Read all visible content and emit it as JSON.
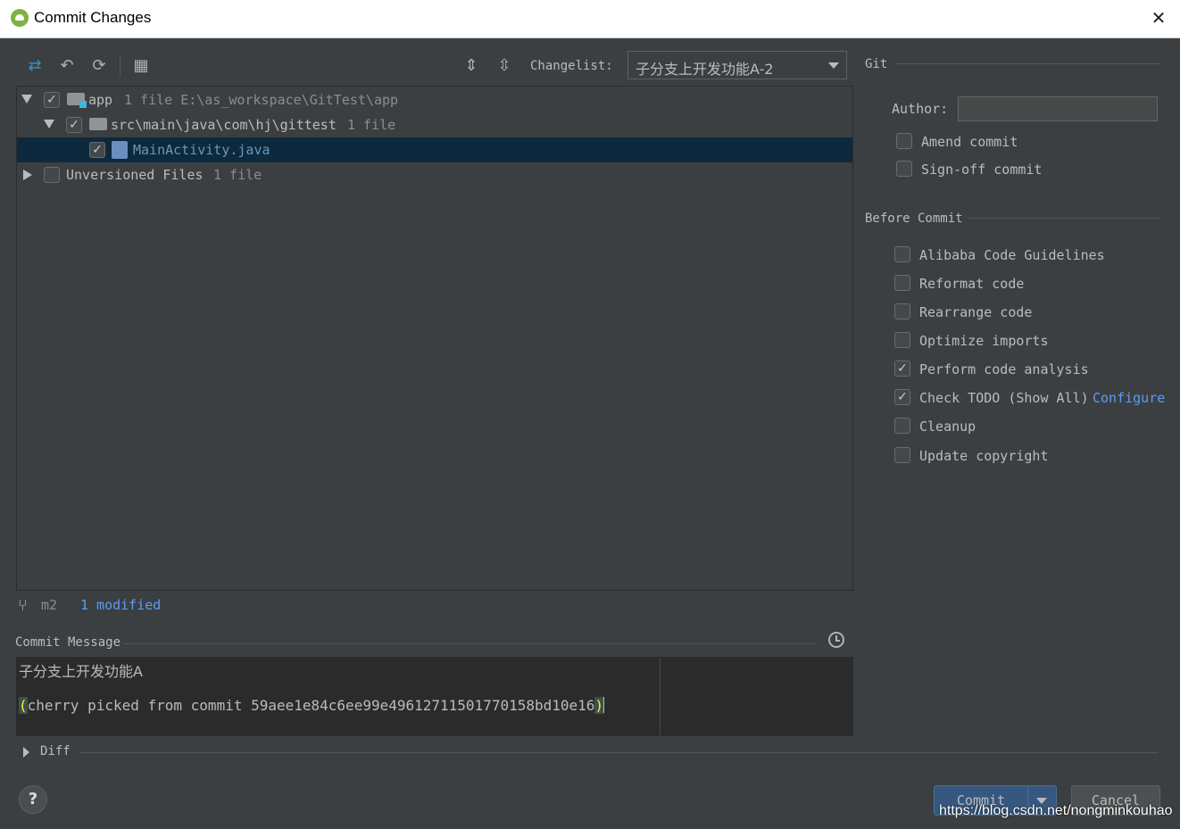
{
  "window": {
    "title": "Commit Changes",
    "close_glyph": "✕"
  },
  "toolbar": {
    "icons": [
      "show-diff-icon",
      "rollback-icon",
      "refresh-icon",
      "group-by-icon",
      "expand-all-icon",
      "collapse-all-icon"
    ],
    "changelist_label": "Changelist:",
    "changelist_value": "子分支上开发功能A-2"
  },
  "tree": {
    "rows": [
      {
        "name": "app",
        "info": "1 file E:\\as_workspace\\GitTest\\app",
        "checked": true
      },
      {
        "name": "src\\main\\java\\com\\hj\\gittest",
        "info": "1 file",
        "checked": true
      },
      {
        "name": "MainActivity.java",
        "info": "",
        "checked": true
      },
      {
        "name": "Unversioned Files",
        "info": "1 file",
        "checked": false
      }
    ]
  },
  "status": {
    "branch": "m2",
    "modified": "1 modified"
  },
  "commit_message": {
    "label": "Commit Message",
    "line1": "子分支上开发功能A",
    "line2_open": "(",
    "line2_body": "cherry picked from commit 59aee1e84c6ee99e49612711501770158bd10e16",
    "line2_close": ")"
  },
  "diff": {
    "label": "Diff"
  },
  "git": {
    "section_label": "Git",
    "author_label": "Author:",
    "author_value": "",
    "amend_commit": {
      "label": "Amend commit",
      "checked": false
    },
    "signoff_commit": {
      "label": "Sign-off commit",
      "checked": false
    }
  },
  "before_commit": {
    "section_label": "Before Commit",
    "options": [
      {
        "label": "Alibaba Code Guidelines",
        "checked": false
      },
      {
        "label": "Reformat code",
        "checked": false
      },
      {
        "label": "Rearrange code",
        "checked": false
      },
      {
        "label": "Optimize imports",
        "checked": false
      },
      {
        "label": "Perform code analysis",
        "checked": true
      },
      {
        "label": "Check TODO (Show All)",
        "checked": true,
        "link": "Configure"
      },
      {
        "label": "Cleanup",
        "checked": false
      },
      {
        "label": "Update copyright",
        "checked": false
      }
    ]
  },
  "buttons": {
    "help": "?",
    "commit": "Commit",
    "cancel": "Cancel"
  },
  "watermark": "https://blog.csdn.net/nongminkouhao",
  "colors": {
    "background": "#3c3f41",
    "selection": "#0d293e",
    "link": "#589df6",
    "commit_button": "#365880"
  }
}
